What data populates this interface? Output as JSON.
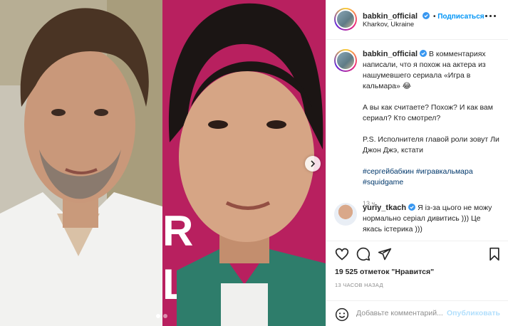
{
  "post": {
    "username": "babkin_official",
    "follow_label": "Подписаться",
    "location": "Kharkov, Ukraine",
    "caption": {
      "line1": " В комментариях написали, что я похож на актера из нашумевшего сериала «Игра в кальмара» 😂",
      "line2": "А вы как считаете? Похож? И как вам сериал? Кто смотрел?",
      "line3": "P.S. Исполнителя главой роли зовут Ли Джон Джэ, кстати",
      "hashtags": [
        "#сергейбабкин",
        "#игравкальмара",
        "#squidgame"
      ],
      "time": "13 ч."
    },
    "comment": {
      "username": "yuriy_tkach",
      "text": " Я із-за цього не можу нормально серіал дивитись ))) Це якась істерика )))"
    },
    "likes_text": "19 525 отметок \"Нравится\"",
    "ago_text": "13 ЧАСОВ НАЗАД",
    "add_comment_placeholder": "Добавьте комментарий...",
    "publish_label": "Опубликовать"
  },
  "media": {
    "slide_count": 2,
    "active_slide": 1,
    "right_photo_overlay": "R L"
  },
  "icons": [
    "verified-icon",
    "more-icon",
    "heart-icon",
    "comment-icon",
    "share-icon",
    "bookmark-icon",
    "emoji-icon",
    "chevron-right-icon"
  ],
  "colors": {
    "accent": "#0095f6",
    "verified": "#3897f0",
    "hashtag": "#00376b",
    "muted": "#8e8e8e",
    "publish_disabled": "#b2dffc",
    "right_photo_bg": "#b8205f"
  }
}
